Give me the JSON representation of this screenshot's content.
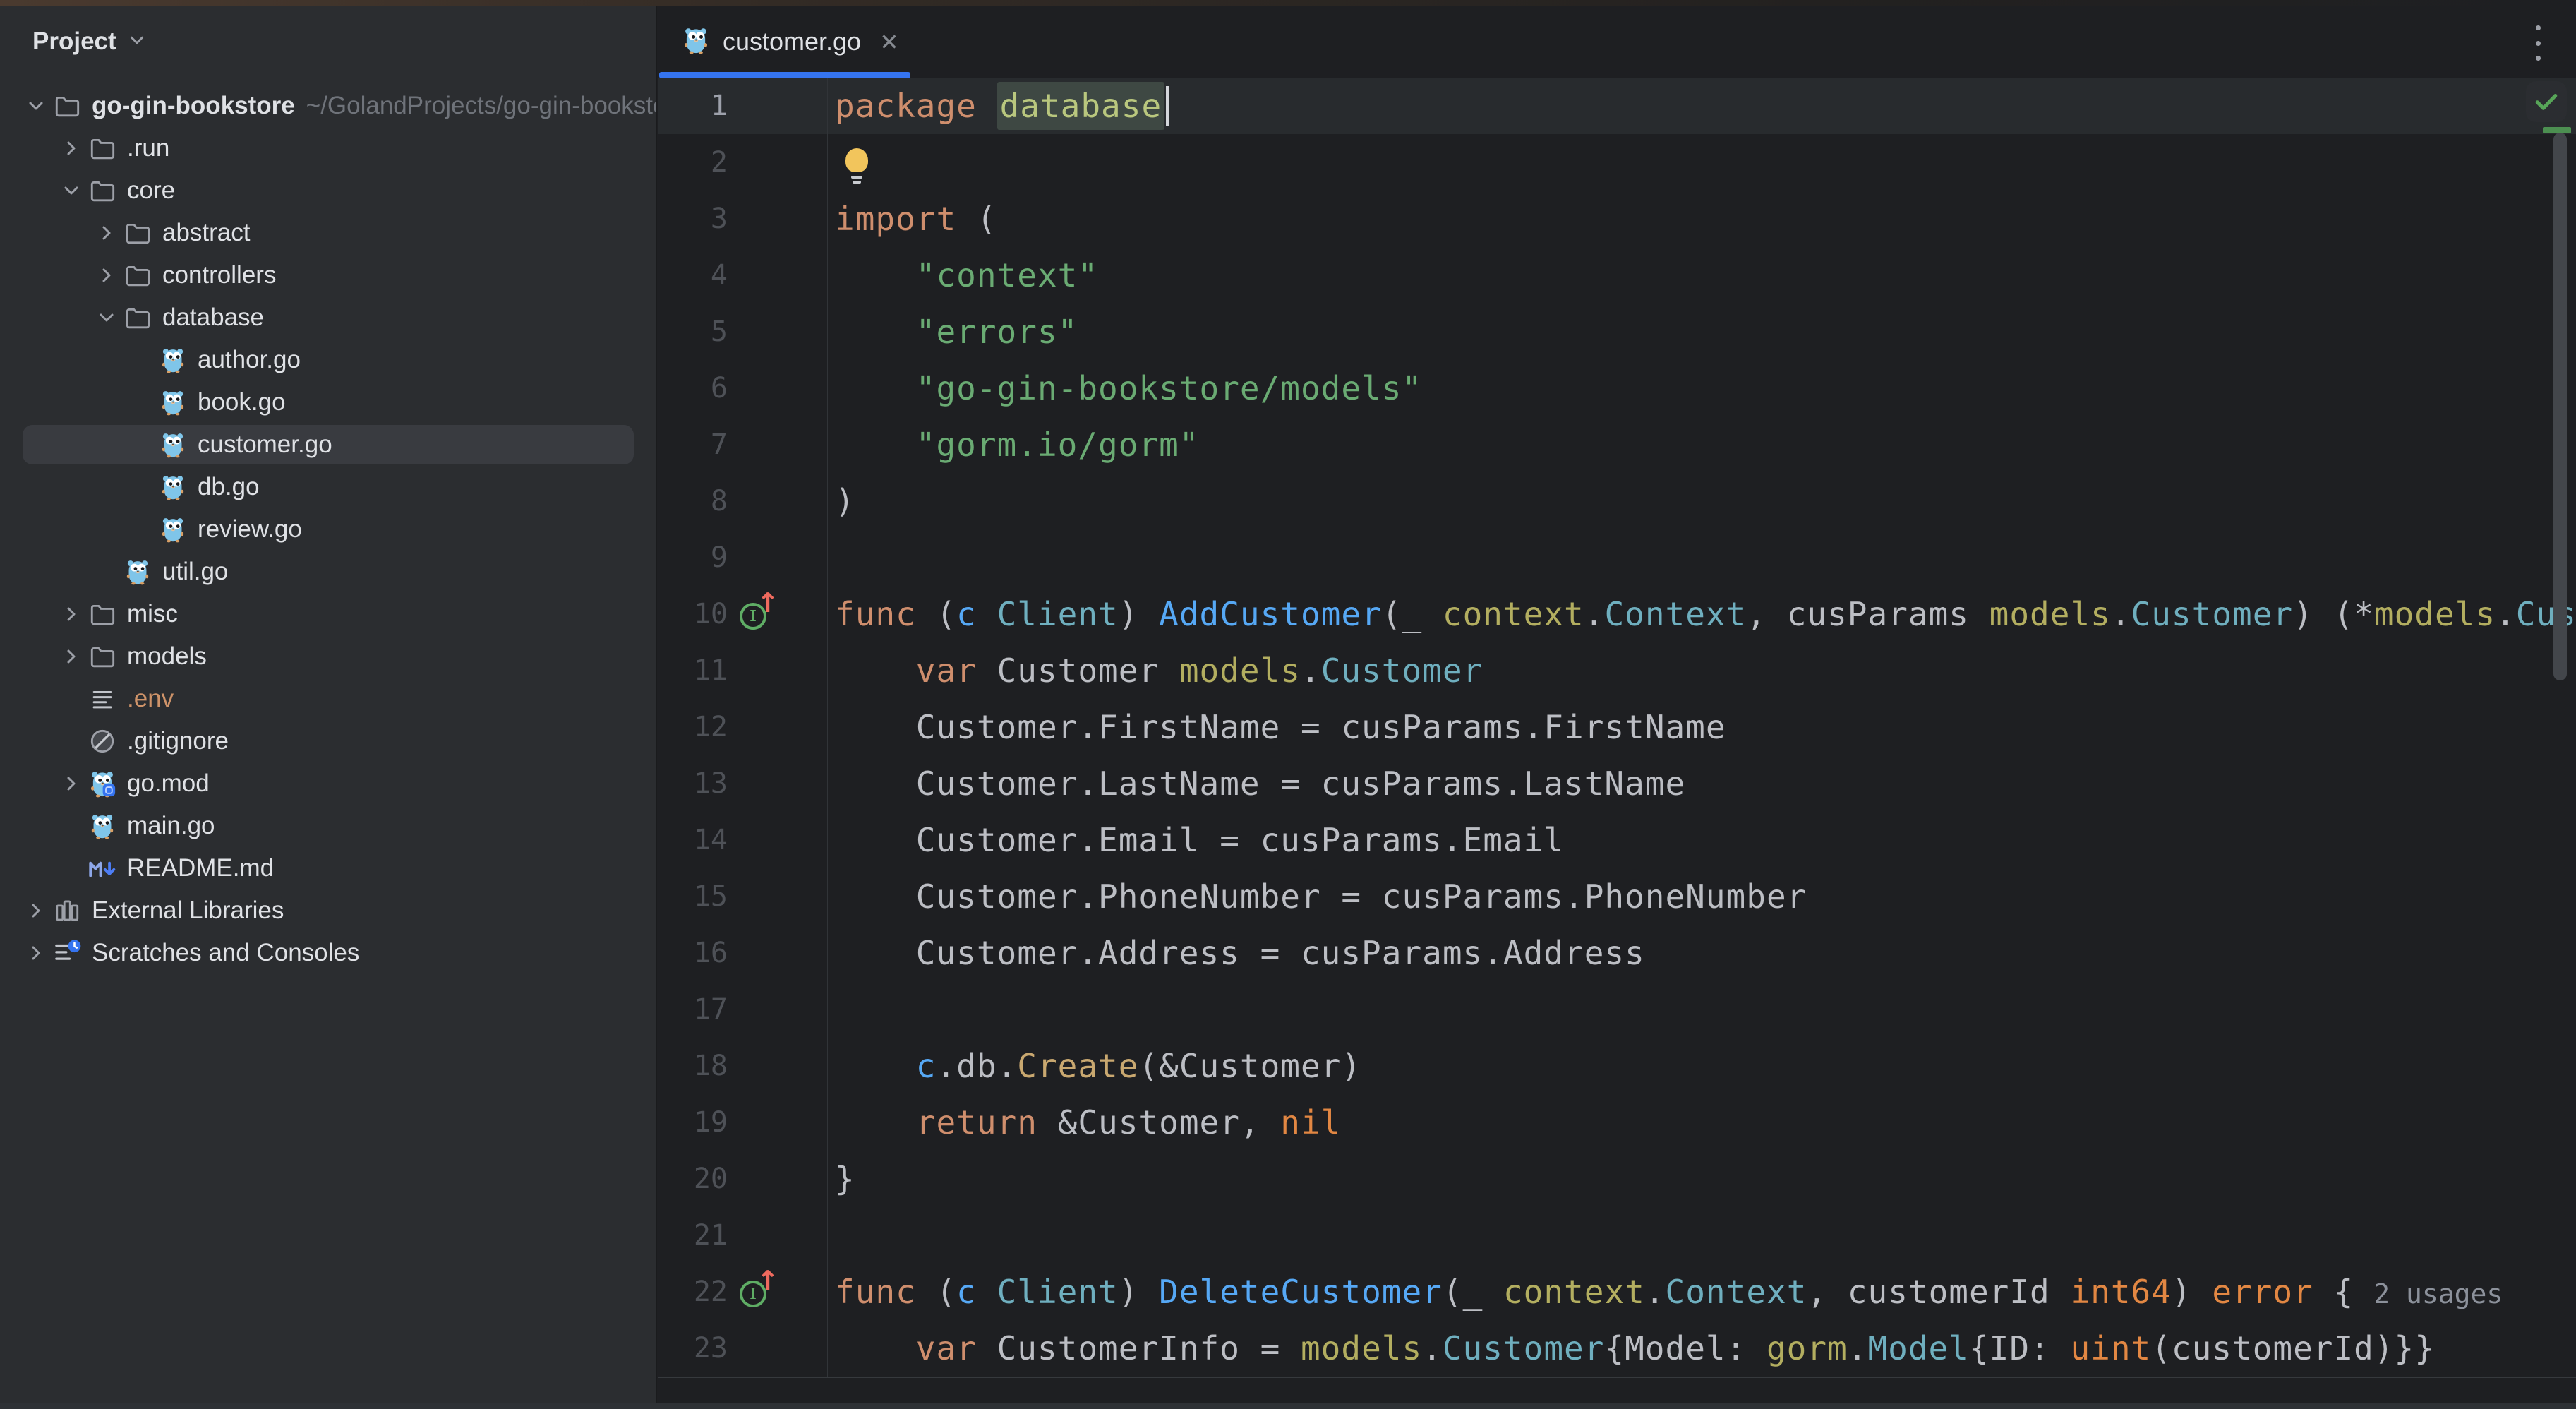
{
  "colors": {
    "accent": "#3574F0",
    "panel_background": "#2B2D30",
    "editor_background": "#1E1F22",
    "selected_row": "#393B40",
    "current_line": "#282B2E",
    "keyword_orange": "#CF8E6D",
    "string_green": "#6AAB73",
    "function_blue": "#56A8F5",
    "type_teal": "#6FAFBF",
    "package_olive": "#B3AE60",
    "builtin_orange": "#E28743",
    "check_green": "#57A558",
    "tab_underline": "#3574F0"
  },
  "sidebar": {
    "title": "Project",
    "items": [
      {
        "label": "go-gin-bookstore",
        "suffix": "~/GolandProjects/go-gin-bookstore",
        "depth": 0,
        "chevron": "down",
        "icon": "folder",
        "bold": true,
        "selected": false
      },
      {
        "label": ".run",
        "depth": 1,
        "chevron": "right",
        "icon": "folder"
      },
      {
        "label": "core",
        "depth": 1,
        "chevron": "down",
        "icon": "folder"
      },
      {
        "label": "abstract",
        "depth": 2,
        "chevron": "right",
        "icon": "folder"
      },
      {
        "label": "controllers",
        "depth": 2,
        "chevron": "right",
        "icon": "folder"
      },
      {
        "label": "database",
        "depth": 2,
        "chevron": "down",
        "icon": "folder"
      },
      {
        "label": "author.go",
        "depth": 3,
        "chevron": "none",
        "icon": "go-file"
      },
      {
        "label": "book.go",
        "depth": 3,
        "chevron": "none",
        "icon": "go-file"
      },
      {
        "label": "customer.go",
        "depth": 3,
        "chevron": "none",
        "icon": "go-file",
        "selected": true
      },
      {
        "label": "db.go",
        "depth": 3,
        "chevron": "none",
        "icon": "go-file"
      },
      {
        "label": "review.go",
        "depth": 3,
        "chevron": "none",
        "icon": "go-file"
      },
      {
        "label": "util.go",
        "depth": 2,
        "chevron": "none",
        "icon": "go-file"
      },
      {
        "label": "misc",
        "depth": 1,
        "chevron": "right",
        "icon": "folder"
      },
      {
        "label": "models",
        "depth": 1,
        "chevron": "right",
        "icon": "folder"
      },
      {
        "label": ".env",
        "depth": 1,
        "chevron": "none",
        "icon": "env-file",
        "label_color": "#CE9369"
      },
      {
        "label": ".gitignore",
        "depth": 1,
        "chevron": "none",
        "icon": "gitignore"
      },
      {
        "label": "go.mod",
        "depth": 1,
        "chevron": "right",
        "icon": "go-mod"
      },
      {
        "label": "main.go",
        "depth": 1,
        "chevron": "none",
        "icon": "go-file"
      },
      {
        "label": "README.md",
        "depth": 1,
        "chevron": "none",
        "icon": "markdown"
      },
      {
        "label": "External Libraries",
        "depth": 0,
        "chevron": "right",
        "icon": "libraries"
      },
      {
        "label": "Scratches and Consoles",
        "depth": 0,
        "chevron": "right",
        "icon": "scratches"
      }
    ]
  },
  "editor": {
    "tab": {
      "label": "customer.go",
      "icon": "go-gopher",
      "close_glyph": "✕"
    },
    "inspection_status": "no-problems",
    "lines": [
      {
        "num": 1,
        "current": true,
        "tokens": [
          [
            "kw",
            "package"
          ],
          [
            "plain",
            " "
          ],
          [
            "pkgdecl-hl",
            "database"
          ],
          [
            "caret",
            ""
          ]
        ]
      },
      {
        "num": 2,
        "tokens": [
          [
            "bulb",
            ""
          ]
        ]
      },
      {
        "num": 3,
        "tokens": [
          [
            "kw",
            "import"
          ],
          [
            "plain",
            " ("
          ]
        ]
      },
      {
        "num": 4,
        "tokens": [
          [
            "plain",
            "    "
          ],
          [
            "str",
            "\"context\""
          ]
        ]
      },
      {
        "num": 5,
        "tokens": [
          [
            "plain",
            "    "
          ],
          [
            "str",
            "\"errors\""
          ]
        ]
      },
      {
        "num": 6,
        "tokens": [
          [
            "plain",
            "    "
          ],
          [
            "str",
            "\"go-gin-bookstore/models\""
          ]
        ]
      },
      {
        "num": 7,
        "tokens": [
          [
            "plain",
            "    "
          ],
          [
            "str",
            "\"gorm.io/gorm\""
          ]
        ]
      },
      {
        "num": 8,
        "tokens": [
          [
            "plain",
            ")"
          ]
        ]
      },
      {
        "num": 9,
        "tokens": []
      },
      {
        "num": 10,
        "gutter_icon": "implements",
        "tokens": [
          [
            "kw",
            "func"
          ],
          [
            "plain",
            " ("
          ],
          [
            "recv",
            "c"
          ],
          [
            "plain",
            " "
          ],
          [
            "type",
            "Client"
          ],
          [
            "plain",
            ") "
          ],
          [
            "fn",
            "AddCustomer"
          ],
          [
            "plain",
            "(_ "
          ],
          [
            "pkg",
            "context"
          ],
          [
            "plain",
            "."
          ],
          [
            "type",
            "Context"
          ],
          [
            "plain",
            ", cusParams "
          ],
          [
            "pkg",
            "models"
          ],
          [
            "plain",
            "."
          ],
          [
            "type",
            "Customer"
          ],
          [
            "plain",
            ") (*"
          ],
          [
            "pkg",
            "models"
          ],
          [
            "plain",
            "."
          ],
          [
            "type",
            "Cus"
          ]
        ]
      },
      {
        "num": 11,
        "tokens": [
          [
            "plain",
            "    "
          ],
          [
            "kw",
            "var"
          ],
          [
            "plain",
            " Customer "
          ],
          [
            "pkg",
            "models"
          ],
          [
            "plain",
            "."
          ],
          [
            "type",
            "Customer"
          ]
        ]
      },
      {
        "num": 12,
        "tokens": [
          [
            "plain",
            "    Customer.FirstName = cusParams.FirstName"
          ]
        ]
      },
      {
        "num": 13,
        "tokens": [
          [
            "plain",
            "    Customer.LastName = cusParams.LastName"
          ]
        ]
      },
      {
        "num": 14,
        "tokens": [
          [
            "plain",
            "    Customer.Email = cusParams.Email"
          ]
        ]
      },
      {
        "num": 15,
        "tokens": [
          [
            "plain",
            "    Customer.PhoneNumber = cusParams.PhoneNumber"
          ]
        ]
      },
      {
        "num": 16,
        "tokens": [
          [
            "plain",
            "    Customer.Address = cusParams.Address"
          ]
        ]
      },
      {
        "num": 17,
        "tokens": []
      },
      {
        "num": 18,
        "tokens": [
          [
            "plain",
            "    "
          ],
          [
            "recv",
            "c"
          ],
          [
            "plain",
            ".db."
          ],
          [
            "call",
            "Create"
          ],
          [
            "plain",
            "(&Customer)"
          ]
        ]
      },
      {
        "num": 19,
        "tokens": [
          [
            "plain",
            "    "
          ],
          [
            "kw",
            "return"
          ],
          [
            "plain",
            " &Customer, "
          ],
          [
            "builtin",
            "nil"
          ]
        ]
      },
      {
        "num": 20,
        "tokens": [
          [
            "plain",
            "}"
          ]
        ]
      },
      {
        "num": 21,
        "tokens": []
      },
      {
        "num": 22,
        "gutter_icon": "implements",
        "tokens": [
          [
            "kw",
            "func"
          ],
          [
            "plain",
            " ("
          ],
          [
            "recv",
            "c"
          ],
          [
            "plain",
            " "
          ],
          [
            "type",
            "Client"
          ],
          [
            "plain",
            ") "
          ],
          [
            "fn",
            "DeleteCustomer"
          ],
          [
            "plain",
            "(_ "
          ],
          [
            "pkg",
            "context"
          ],
          [
            "plain",
            "."
          ],
          [
            "type",
            "Context"
          ],
          [
            "plain",
            ", customerId "
          ],
          [
            "builtin",
            "int64"
          ],
          [
            "plain",
            ") "
          ],
          [
            "builtin",
            "error"
          ],
          [
            "plain",
            " {"
          ],
          [
            "hint",
            "2 usages"
          ]
        ]
      },
      {
        "num": 23,
        "tokens": [
          [
            "plain",
            "    "
          ],
          [
            "kw",
            "var"
          ],
          [
            "plain",
            " CustomerInfo = "
          ],
          [
            "pkg",
            "models"
          ],
          [
            "plain",
            "."
          ],
          [
            "type",
            "Customer"
          ],
          [
            "plain",
            "{Model: "
          ],
          [
            "pkg",
            "gorm"
          ],
          [
            "plain",
            "."
          ],
          [
            "type",
            "Model"
          ],
          [
            "plain",
            "{ID: "
          ],
          [
            "builtin",
            "uint"
          ],
          [
            "plain",
            "(customerId)}}"
          ]
        ]
      }
    ]
  }
}
